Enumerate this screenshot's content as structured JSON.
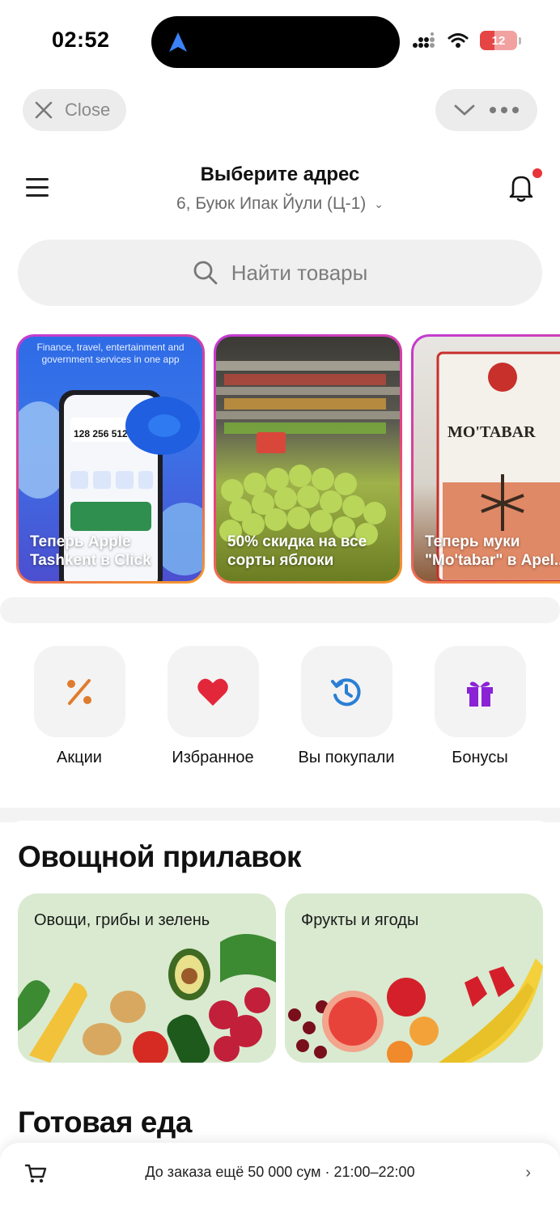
{
  "status_bar": {
    "time": "02:52",
    "battery": "12"
  },
  "mini_app_bar": {
    "close_label": "Close"
  },
  "header": {
    "title": "Выберите адрес",
    "address": "6, Буюк Ипак Йули (Ц-1)"
  },
  "search": {
    "placeholder": "Найти товары"
  },
  "stories": [
    {
      "label": "Теперь Apple Tashkent в Click",
      "top_text": "Finance, travel, entertainment and government services in one app"
    },
    {
      "label": "50% скидка на все сорты яблоки"
    },
    {
      "label": "Теперь муки \"Mo'tabar\" в Apel..."
    }
  ],
  "quick_actions": [
    {
      "label": "Акции",
      "icon": "percent-icon",
      "color": "#e07b2e"
    },
    {
      "label": "Избранное",
      "icon": "heart-icon",
      "color": "#e3273b"
    },
    {
      "label": "Вы покупали",
      "icon": "history-icon",
      "color": "#2a7fd4"
    },
    {
      "label": "Бонусы",
      "icon": "gift-icon",
      "color": "#8a22d6"
    }
  ],
  "sections": {
    "veg_title": "Овощной прилавок",
    "categories": [
      {
        "label": "Овощи, грибы и зелень"
      },
      {
        "label": "Фрукты и ягоды"
      }
    ],
    "ready_food_title": "Готовая еда"
  },
  "bottom_bar": {
    "text": "До заказа ещё 50 000 сум · 21:00–22:00"
  },
  "colors": {
    "accent_red": "#e8333b",
    "bg": "#ffffff",
    "gray": "#f0f0f0"
  }
}
